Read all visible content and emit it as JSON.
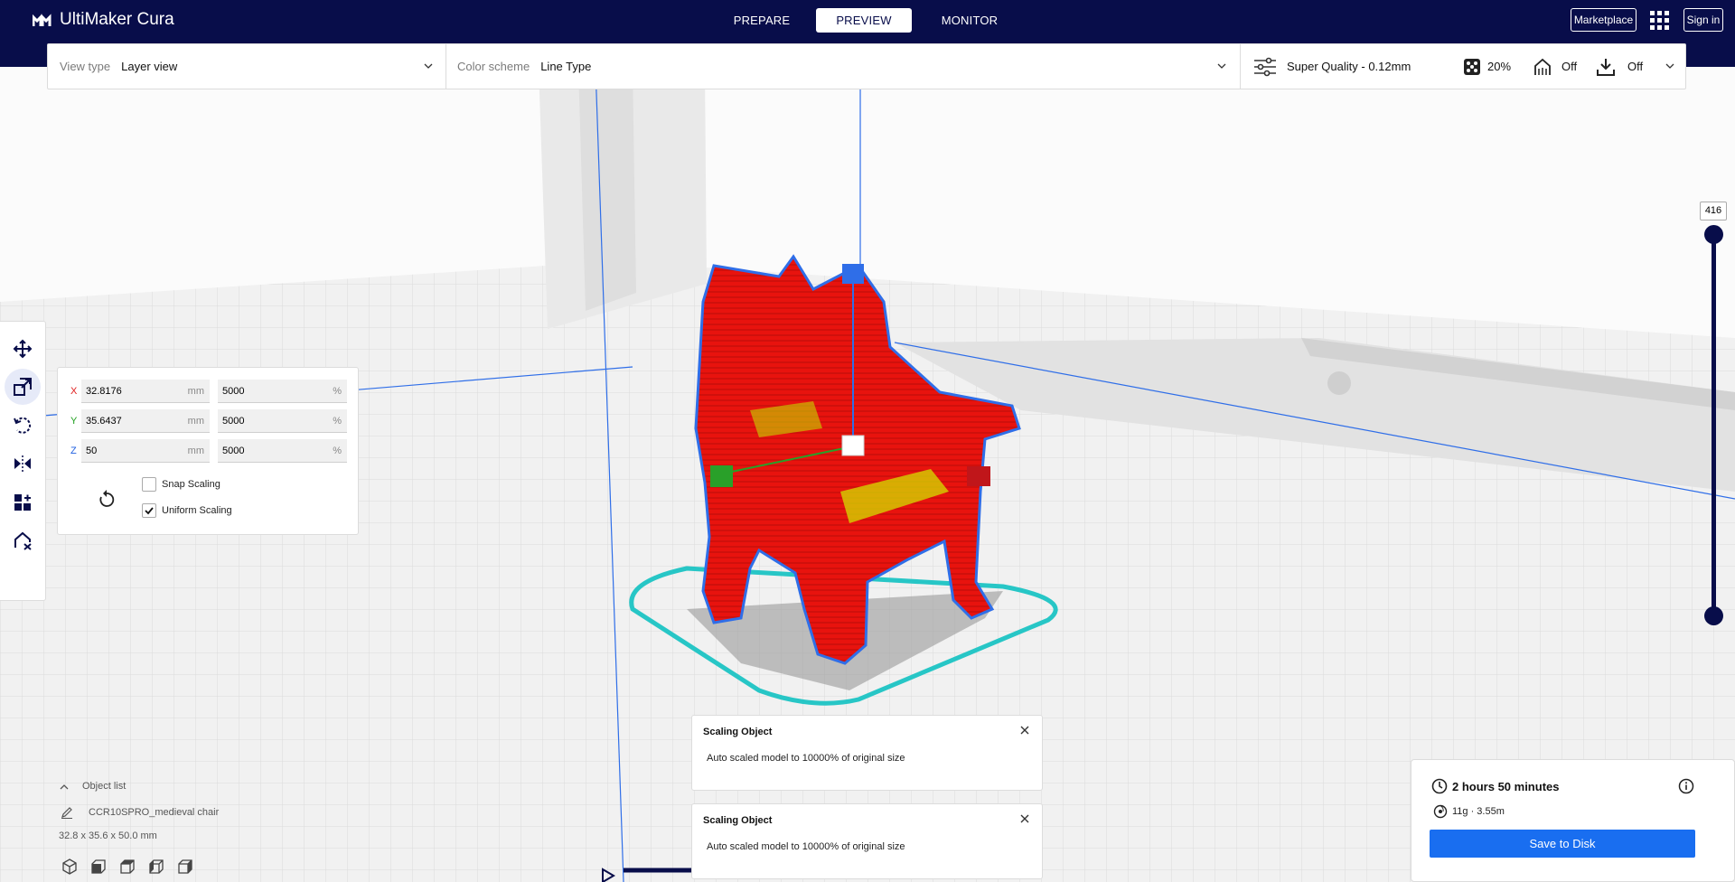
{
  "app": {
    "name": "UltiMaker Cura"
  },
  "header": {
    "stages": [
      {
        "label": "PREPARE",
        "active": false
      },
      {
        "label": "PREVIEW",
        "active": true
      },
      {
        "label": "MONITOR",
        "active": false
      }
    ],
    "marketplace_label": "Marketplace",
    "signin_label": "Sign in"
  },
  "settings_bar": {
    "view_type_label": "View type",
    "view_type_value": "Layer view",
    "color_scheme_label": "Color scheme",
    "color_scheme_value": "Line Type",
    "profile": "Super Quality - 0.12mm",
    "infill": "20%",
    "support": "Off",
    "adhesion": "Off"
  },
  "toolbar": {
    "tools": [
      {
        "name": "move-tool",
        "icon": "move-icon",
        "active": false
      },
      {
        "name": "scale-tool",
        "icon": "scale-icon",
        "active": true
      },
      {
        "name": "rotate-tool",
        "icon": "rotate-icon",
        "active": false
      },
      {
        "name": "mirror-tool",
        "icon": "mirror-icon",
        "active": false
      },
      {
        "name": "per-model-settings-tool",
        "icon": "per-model-settings-icon",
        "active": false
      },
      {
        "name": "support-blocker-tool",
        "icon": "support-blocker-icon",
        "active": false
      }
    ]
  },
  "scale_panel": {
    "x": {
      "axis": "X",
      "mm": "32.8176",
      "percent": "5000",
      "color": "#e02020"
    },
    "y": {
      "axis": "Y",
      "mm": "35.6437",
      "percent": "5000",
      "color": "#20a020"
    },
    "z": {
      "axis": "Z",
      "mm": "50",
      "percent": "5000",
      "color": "#2060e0"
    },
    "unit_mm": "mm",
    "unit_percent": "%",
    "snap_scaling_label": "Snap Scaling",
    "snap_scaling": false,
    "uniform_scaling_label": "Uniform Scaling",
    "uniform_scaling": true
  },
  "layer_slider": {
    "value": "416"
  },
  "notifications": [
    {
      "title": "Scaling Object",
      "message": "Auto scaled model to 10000% of original size"
    },
    {
      "title": "Scaling Object",
      "message": "Auto scaled model to 10000% of original size"
    }
  ],
  "object_list": {
    "title": "Object list",
    "object_name": "CCR10SPRO_medieval chair",
    "dimensions": "32.8 x 35.6 x 50.0 mm"
  },
  "print_info": {
    "time": "2 hours 50 minutes",
    "material": "11g · 3.55m",
    "save_label": "Save to Disk"
  },
  "colors": {
    "header_bg": "#080d4a",
    "accent_blue": "#196ef0",
    "model_red": "#e8130e",
    "skirt_cyan": "#27c6c6"
  }
}
